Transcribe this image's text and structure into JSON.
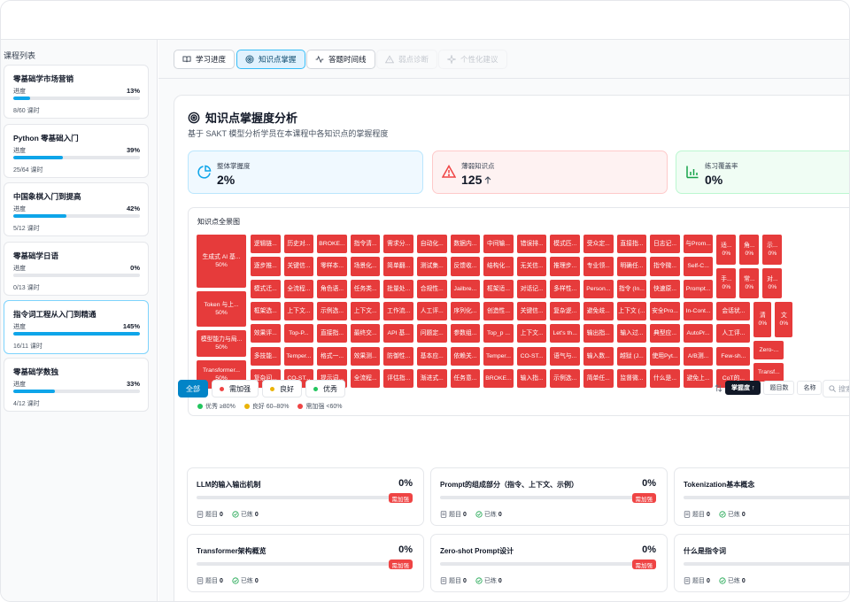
{
  "sidebar": {
    "title": "课程列表",
    "progress_label": "进度",
    "courses": [
      {
        "name": "零基础学市场营销",
        "pct": "13%",
        "progress": 0.13,
        "lessons": "8/60 课时"
      },
      {
        "name": "Python 零基础入门",
        "pct": "39%",
        "progress": 0.39,
        "lessons": "25/64 课时"
      },
      {
        "name": "中国象棋入门到提高",
        "pct": "42%",
        "progress": 0.42,
        "lessons": "5/12 课时"
      },
      {
        "name": "零基础学日语",
        "pct": "0%",
        "progress": 0,
        "lessons": "0/13 课时"
      },
      {
        "name": "指令词工程从入门到精通",
        "pct": "145%",
        "progress": 1.0,
        "lessons": "16/11 课时"
      },
      {
        "name": "零基础学数独",
        "pct": "33%",
        "progress": 0.33,
        "lessons": "4/12 课时"
      }
    ]
  },
  "tabs": [
    {
      "label": "学习进度",
      "icon": "book-icon"
    },
    {
      "label": "知识点掌握",
      "icon": "target-icon"
    },
    {
      "label": "答题时间线",
      "icon": "activity-icon"
    },
    {
      "label": "弱点诊断",
      "icon": "warning-icon"
    },
    {
      "label": "个性化建议",
      "icon": "sparkle-icon"
    }
  ],
  "panel": {
    "title": "知识点掌握度分析",
    "subtitle": "基于 SAKT 模型分析学员在本课程中各知识点的掌握程度"
  },
  "stats": [
    {
      "label": "整体掌握度",
      "value": "2%",
      "icon": "pie-chart-icon",
      "color": "#0ea5e9"
    },
    {
      "label": "薄弱知识点",
      "value": "125",
      "icon": "alert-triangle-icon",
      "color": "#ef4444"
    },
    {
      "label": "练习覆盖率",
      "value": "0%",
      "icon": "bar-chart-icon",
      "color": "#16a34a"
    }
  ],
  "treemap": {
    "title": "知识点全景图",
    "big": [
      {
        "name": "生成式 AI 基...",
        "pct": "50%"
      },
      {
        "name": "Token 与上...",
        "pct": "50%"
      },
      {
        "name": "模型能力与局...",
        "pct": "50%"
      },
      {
        "name": "Transformer...",
        "pct": "50%"
      }
    ],
    "grid": [
      [
        "逻辑链...",
        "历史对...",
        "BROKE...",
        "指令清...",
        "需求分...",
        "自动化...",
        "数据内...",
        "中间输...",
        "错误排...",
        "模式匹...",
        "受众定...",
        "直接指...",
        "日志记...",
        "与Prom..."
      ],
      [
        "逐步推...",
        "关键信...",
        "零样本...",
        "场景化...",
        "简单翻...",
        "测试集...",
        "反馈收...",
        "结构化...",
        "无关信...",
        "推理步...",
        "专业领...",
        "明确任...",
        "指令微...",
        "Self-C..."
      ],
      [
        "模式迁...",
        "全流程...",
        "角色语...",
        "任务类...",
        "批量处...",
        "合规性...",
        "Jailbre...",
        "框架适...",
        "对话记...",
        "多样性...",
        "Person...",
        "指令 (In...",
        "快速原...",
        "Prompt..."
      ],
      [
        "框架选...",
        "上下文...",
        "示例选...",
        "上下文...",
        "工作流...",
        "人工评...",
        "序列化...",
        "创造性...",
        "关键信...",
        "复杂逻...",
        "避免歧...",
        "上下文 (...",
        "安全Pro...",
        "In-Cont..."
      ],
      [
        "效果评...",
        "Top-P...",
        "直接指...",
        "最终交...",
        "API 基...",
        "问题定...",
        "参数组...",
        "Top_p ...",
        "上下文...",
        "Let's th...",
        "输出指...",
        "输入过...",
        "典型应...",
        "AutoPr..."
      ],
      [
        "多技能...",
        "Temper...",
        "格式一...",
        "效果测...",
        "防御性...",
        "基本应...",
        "依赖关...",
        "Temper...",
        "CO-ST...",
        "语气与...",
        "输入数...",
        "越狱 (J...",
        "使用Pyt...",
        "A/B测..."
      ],
      [
        "复杂问...",
        "CO-ST...",
        "提示词...",
        "全流程...",
        "评估指...",
        "渐进式...",
        "任务意...",
        "BROKE...",
        "输入指...",
        "示例选...",
        "简单任...",
        "监督微...",
        "什么是...",
        "避免上..."
      ]
    ],
    "right": {
      "top_small": [
        {
          "name": "适...",
          "pct": "0%"
        },
        {
          "name": "角...",
          "pct": "0%"
        },
        {
          "name": "示...",
          "pct": "0%"
        }
      ],
      "mid_small": [
        {
          "name": "手...",
          "pct": "0%"
        },
        {
          "name": "常...",
          "pct": "0%"
        },
        {
          "name": "对...",
          "pct": "0%"
        }
      ],
      "row_labels": [
        "会话状...",
        "人工评...",
        "Few-sh...",
        "CoT的..."
      ],
      "tiny": [
        {
          "name": "清",
          "pct": "0%"
        },
        {
          "name": "文",
          "pct": "0%"
        }
      ],
      "tail": [
        "Zero-...",
        "Transf..."
      ]
    },
    "legend": [
      {
        "label": "优秀 ≥80%",
        "color": "#22c55e"
      },
      {
        "label": "良好 60–80%",
        "color": "#eab308"
      },
      {
        "label": "需加强 <60%",
        "color": "#ef4444"
      }
    ]
  },
  "filters": [
    {
      "label": "全部",
      "color": ""
    },
    {
      "label": "需加强",
      "color": "#ef4444"
    },
    {
      "label": "良好",
      "color": "#eab308"
    },
    {
      "label": "优秀",
      "color": "#22c55e"
    }
  ],
  "sort": {
    "options": [
      "掌握度 ↑",
      "题目数",
      "名称"
    ],
    "search_placeholder": "搜索"
  },
  "cards": [
    {
      "title": "LLM的输入输出机制",
      "pct": "0%",
      "badge": "需加强",
      "q_label": "题目",
      "q": "0",
      "done_label": "已练",
      "done": "0"
    },
    {
      "title": "Prompt的组成部分（指令、上下文、示例）",
      "pct": "0%",
      "badge": "需加强",
      "q_label": "题目",
      "q": "0",
      "done_label": "已练",
      "done": "0"
    },
    {
      "title": "Tokenization基本概念",
      "pct": "",
      "badge": "",
      "q_label": "题目",
      "q": "0",
      "done_label": "已练",
      "done": "0"
    },
    {
      "title": "Transformer架构概览",
      "pct": "0%",
      "badge": "需加强",
      "q_label": "题目",
      "q": "0",
      "done_label": "已练",
      "done": "0"
    },
    {
      "title": "Zero-shot Prompt设计",
      "pct": "0%",
      "badge": "需加强",
      "q_label": "题目",
      "q": "0",
      "done_label": "已练",
      "done": "0"
    },
    {
      "title": "什么是指令词",
      "pct": "",
      "badge": "",
      "q_label": "题目",
      "q": "0",
      "done_label": "已练",
      "done": "0"
    }
  ]
}
